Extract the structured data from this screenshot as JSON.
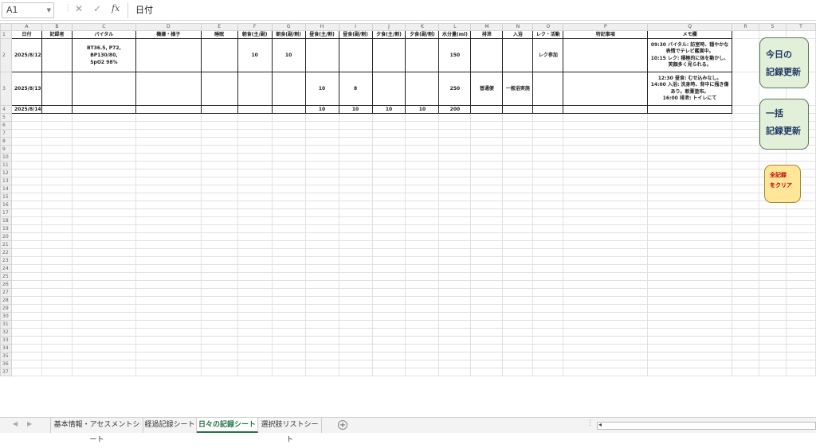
{
  "formula_bar": {
    "name_box": "A1",
    "cancel_icon": "✕",
    "enter_icon": "✓",
    "function_label": "fx",
    "content": "日付"
  },
  "columns": [
    "A",
    "B",
    "C",
    "D",
    "E",
    "F",
    "G",
    "H",
    "I",
    "J",
    "K",
    "L",
    "M",
    "N",
    "O",
    "P",
    "Q",
    "R",
    "S",
    "T"
  ],
  "header_row": [
    "日付",
    "記録者",
    "バイタル",
    "機嫌・様子",
    "睡眠",
    "朝食(主/副)",
    "朝食(副/割)",
    "昼食(主/割)",
    "昼食(副/割)",
    "夕食(主/割)",
    "夕食(副/割)",
    "水分量(ml)",
    "排泄",
    "入浴",
    "レク・活動",
    "特記事項",
    "メモ欄"
  ],
  "rows": [
    {
      "date": "2025/8/12",
      "recorder": "",
      "vital_1": "BT36.5, P72, BP130/80,",
      "vital_2": "SpO2 98%",
      "mood": "",
      "sleep": "",
      "bf_main": "10",
      "bf_side": "10",
      "lunch_main": "",
      "lunch_side": "",
      "dinner_main": "",
      "dinner_side": "",
      "water": "150",
      "excretion": "",
      "bath": "",
      "activity": "レク参加",
      "notes": "",
      "memo": [
        "09:30 バイタル: 訪室時、穏やかな",
        "表情でテレビ鑑賞中。",
        "10:15 レク: 積極的に体を動かし、",
        "笑顔多く見られる。"
      ]
    },
    {
      "date": "2025/8/13",
      "recorder": "",
      "vital_1": "",
      "vital_2": "",
      "mood": "",
      "sleep": "",
      "bf_main": "",
      "bf_side": "",
      "lunch_main": "10",
      "lunch_side": "8",
      "dinner_main": "",
      "dinner_side": "",
      "water": "250",
      "excretion": "普通便",
      "bath": "一般浴実施",
      "activity": "",
      "notes": "",
      "memo": [
        "12:30 昼食: むせ込みなし。",
        "14:00 入浴: 洗身時、背中に掻き傷",
        "あり。軟膏塗布。",
        "16:00 排泄: トイレにて"
      ]
    },
    {
      "date": "2025/8/14",
      "recorder": "",
      "vital_1": "",
      "vital_2": "",
      "mood": "",
      "sleep": "",
      "bf_main": "",
      "bf_side": "",
      "lunch_main": "10",
      "lunch_side": "10",
      "dinner_main": "10",
      "dinner_side": "10",
      "water": "200",
      "excretion": "",
      "bath": "",
      "activity": "",
      "notes": "",
      "memo": [
        "",
        "",
        "",
        ""
      ]
    }
  ],
  "buttons": {
    "today_line1": "今日の",
    "today_line2": "記録更新",
    "bulk_line1": "一括",
    "bulk_line2": "記録更新",
    "clear_line1": "全記録",
    "clear_line2": "をクリア"
  },
  "sheet_tabs": [
    "基本情報・アセスメントシート",
    "経過記録シート",
    "日々の記録シート",
    "選択肢リストシート"
  ],
  "active_tab": "日々の記録シート",
  "colors": {
    "accent": "#217346",
    "button_green": "#e2efd9",
    "button_yellow": "#ffe699",
    "clear_text": "#c00000"
  }
}
